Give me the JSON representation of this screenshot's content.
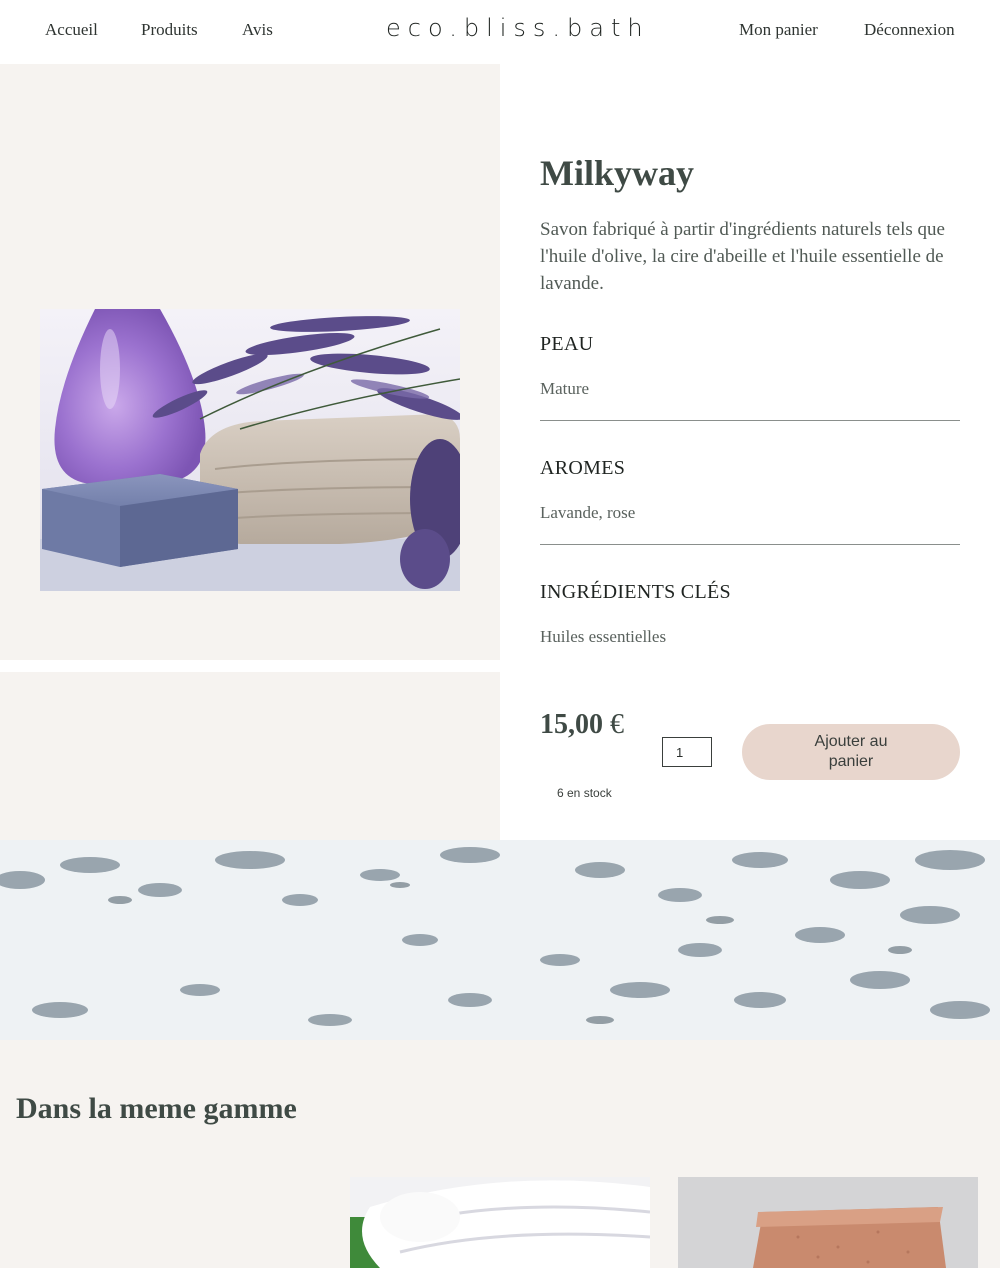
{
  "header": {
    "nav_left": [
      "Accueil",
      "Produits",
      "Avis"
    ],
    "brand": "eco.bliss.bath",
    "nav_right": [
      "Mon panier",
      "Déconnexion"
    ]
  },
  "product": {
    "name": "Milkyway",
    "description": "Savon fabriqué à partir d'ingrédients naturels tels que l'huile d'olive, la cire d'abeille et l'huile essentielle de lavande.",
    "attributes": [
      {
        "label": "PEAU",
        "value": "Mature"
      },
      {
        "label": "AROMES",
        "value": "Lavande, rose"
      },
      {
        "label": "INGRÉDIENTS CLÉS",
        "value": "Huiles essentielles"
      }
    ],
    "price_amount": "15,00",
    "price_currency": "€",
    "stock": "6 en stock",
    "quantity": "1",
    "add_to_cart": "Ajouter au panier"
  },
  "related": {
    "title": "Dans la meme gamme"
  }
}
